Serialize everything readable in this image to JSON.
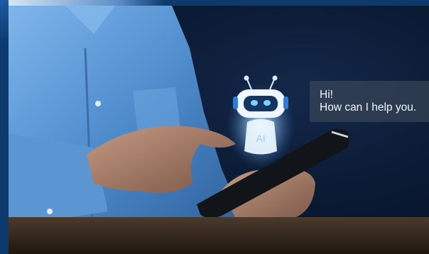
{
  "chat_bubble": {
    "greeting": "Hi!",
    "message": "How can I help you."
  },
  "robot": {
    "chest_label": "AI"
  },
  "colors": {
    "frame_blue": "#0d3a6e",
    "robot_glow": "#bfe3ff",
    "robot_accent": "#2f7bd6",
    "shirt_blue": "#5f9bd6"
  },
  "icons": [
    "robot-chatbot-icon"
  ]
}
